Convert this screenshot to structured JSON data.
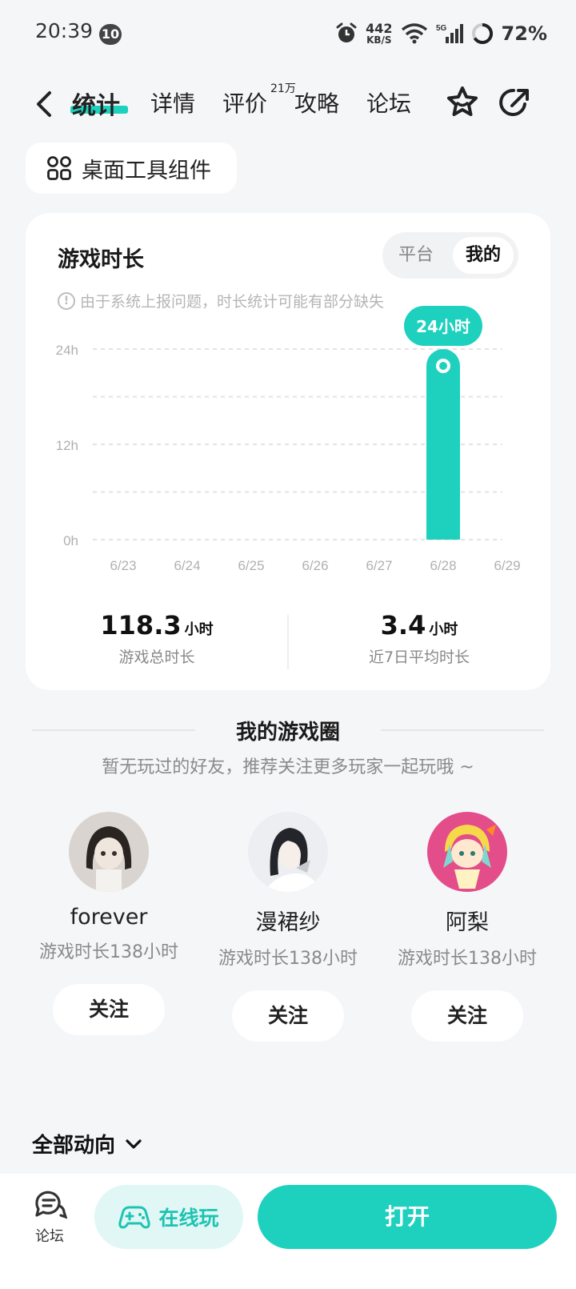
{
  "status_bar": {
    "time": "20:39",
    "notif_count": "10",
    "speed_value": "442",
    "speed_unit": "KB/S",
    "network": "5G",
    "battery": "72%"
  },
  "nav": {
    "tabs": [
      {
        "label": "统计",
        "active": true
      },
      {
        "label": "详情"
      },
      {
        "label": "评价",
        "badge": "21万"
      },
      {
        "label": "攻略"
      },
      {
        "label": "论坛"
      }
    ]
  },
  "widget_button": {
    "label": "桌面工具组件"
  },
  "playtime_card": {
    "title": "游戏时长",
    "toggle": {
      "platform": "平台",
      "mine": "我的",
      "selected": "我的"
    },
    "notice": "由于系统上报问题，时长统计可能有部分缺失",
    "stats": {
      "total_value": "118.3",
      "total_unit": "小时",
      "total_label": "游戏总时长",
      "avg_value": "3.4",
      "avg_unit": "小时",
      "avg_label": "近7日平均时长"
    }
  },
  "chart_data": {
    "type": "bar",
    "categories": [
      "6/23",
      "6/24",
      "6/25",
      "6/26",
      "6/27",
      "6/28",
      "6/29"
    ],
    "values": [
      0,
      0,
      0,
      0,
      0,
      24,
      0
    ],
    "y_ticks": [
      "0h",
      "12h",
      "24h"
    ],
    "ylim": [
      0,
      24
    ],
    "tooltip": {
      "category": "6/28",
      "label": "24小时"
    },
    "grid": true,
    "color": "#1ed1be"
  },
  "game_circle": {
    "title": "我的游戏圈",
    "subtitle": "暂无玩过的好友，推荐关注更多玩家一起玩哦 ~",
    "friends": [
      {
        "name": "forever",
        "playtime": "游戏时长138小时",
        "follow": "关注"
      },
      {
        "name": "漫裙纱",
        "playtime": "游戏时长138小时",
        "follow": "关注"
      },
      {
        "name": "阿梨",
        "playtime": "游戏时长138小时",
        "follow": "关注"
      }
    ]
  },
  "all_moves": {
    "label": "全部动向"
  },
  "bottom_bar": {
    "forum": "论坛",
    "online_play": "在线玩",
    "open": "打开"
  },
  "colors": {
    "accent": "#1ed1be",
    "accent_light": "#e0f7f5"
  }
}
